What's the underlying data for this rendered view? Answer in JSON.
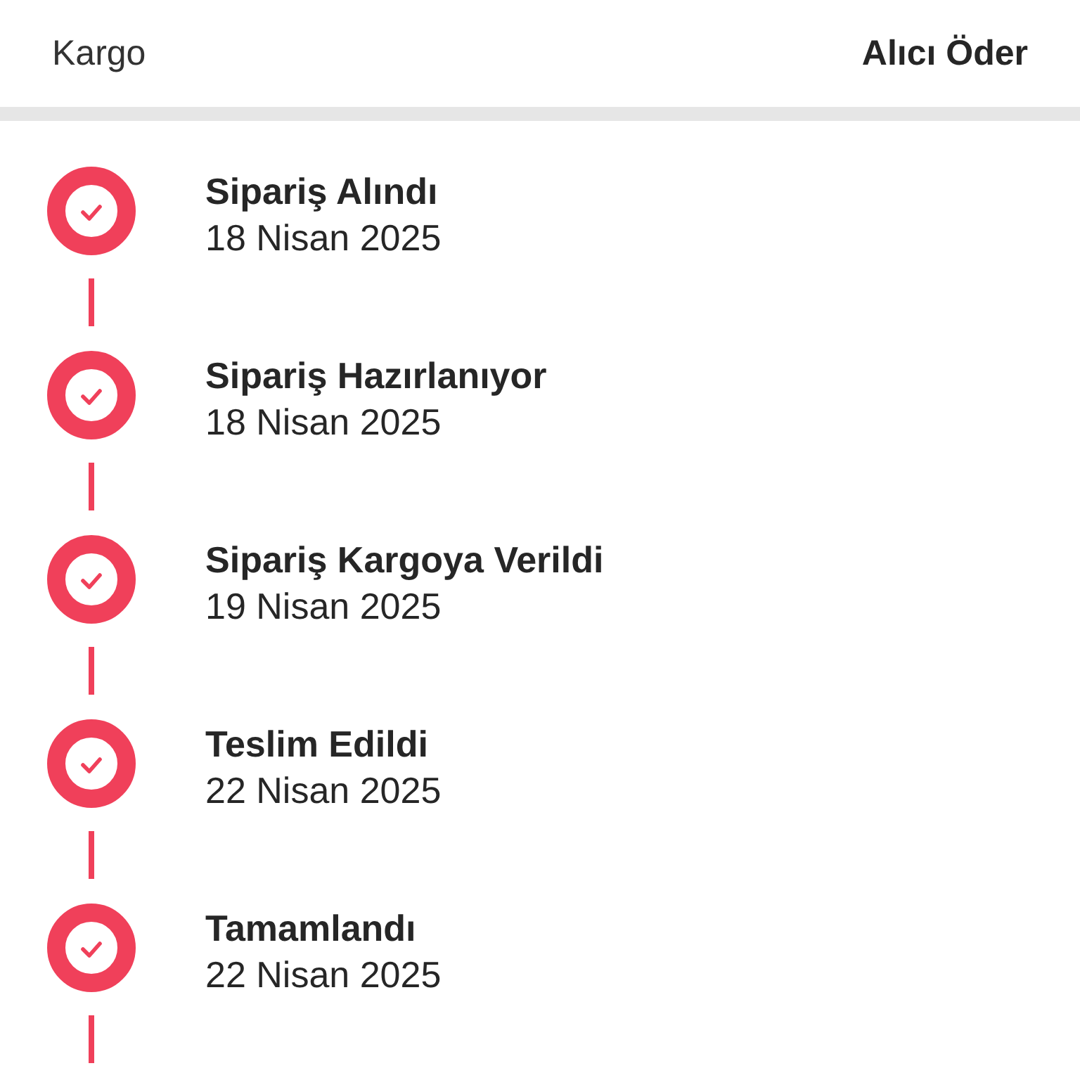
{
  "header": {
    "label": "Kargo",
    "value": "Alıcı Öder"
  },
  "steps": [
    {
      "title": "Sipariş Alındı",
      "date": "18 Nisan 2025",
      "completed": true
    },
    {
      "title": "Sipariş Hazırlanıyor",
      "date": "18 Nisan 2025",
      "completed": true
    },
    {
      "title": "Sipariş Kargoya Verildi",
      "date": "19 Nisan 2025",
      "completed": true
    },
    {
      "title": "Teslim Edildi",
      "date": "22 Nisan 2025",
      "completed": true
    },
    {
      "title": "Tamamlandı",
      "date": "22 Nisan 2025",
      "completed": true
    }
  ]
}
